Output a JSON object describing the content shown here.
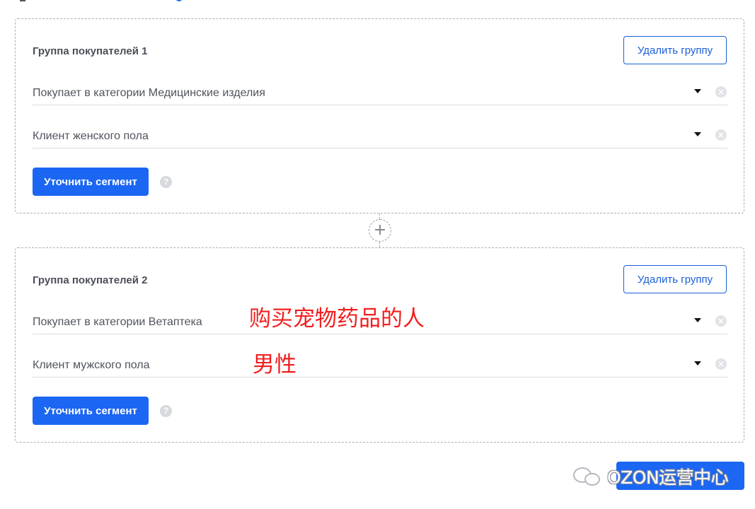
{
  "groups": [
    {
      "title": "Группа покупателей 1",
      "delete_label": "Удалить группу",
      "conditions": [
        {
          "label": "Покупает в категории Медицинские изделия"
        },
        {
          "label": "Клиент женского пола"
        }
      ],
      "refine_label": "Уточнить сегмент",
      "help_glyph": "?"
    },
    {
      "title": "Группа покупателей 2",
      "delete_label": "Удалить группу",
      "conditions": [
        {
          "label": "Покупает в категории Ветаптека"
        },
        {
          "label": "Клиент мужского пола"
        }
      ],
      "refine_label": "Уточнить сегмент",
      "help_glyph": "?"
    }
  ],
  "add_group_glyph": "+",
  "clear_glyph": "×",
  "annotations": {
    "pet_medicine_buyers": "购买宠物药品的人",
    "male": "男性"
  },
  "watermark": {
    "text": "OZON运营中心",
    "icon": "wechat-logo-icon"
  },
  "icons": {
    "dropdown": "chevron-down-icon",
    "clear": "clear-icon",
    "help": "help-icon",
    "add": "plus-icon"
  },
  "colors": {
    "accent": "#1b66f3",
    "annotation": "#f21f1f",
    "border": "#a9adb4"
  }
}
